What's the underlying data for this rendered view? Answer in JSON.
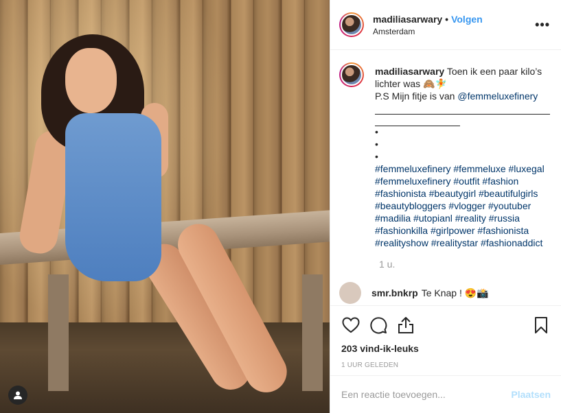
{
  "post": {
    "username": "madiliasarwary",
    "separator": "•",
    "follow_label": "Volgen",
    "location": "Amsterdam",
    "more_icon": "more-horizontal-icon"
  },
  "caption": {
    "username": "madiliasarwary",
    "text_line1": "Toen ik een paar kilo’s lichter was 🙈🧚",
    "text_line2": "P.S Mijn fitje is van ",
    "mention": "@femmeluxefinery",
    "bullets": [
      "•",
      "•",
      "•"
    ],
    "hashtags": "#femmeluxefinery #femmeluxe #luxegal #femmeluxefinery #outfit #fashion #fashionista #beautygirl #beautifulgirls #beautybloggers #vlogger #youtuber #madilia #utopianl #reality #russia #fashionkilla #girlpower #fashionista #realityshow #realitystar #fashionaddict",
    "time_ago": "1 u."
  },
  "first_comment": {
    "username": "smr.bnkrp",
    "text": "Te Knap ! 😍📸"
  },
  "actions": {
    "like_icon": "heart-icon",
    "comment_icon": "comment-icon",
    "share_icon": "share-icon",
    "save_icon": "bookmark-icon",
    "likes_text": "203 vind-ik-leuks",
    "posted_text": "1 UUR GELEDEN"
  },
  "comment_box": {
    "placeholder": "Een reactie toevoegen...",
    "post_label": "Plaatsen"
  },
  "photo": {
    "user_tag_icon": "user-tag-icon"
  }
}
